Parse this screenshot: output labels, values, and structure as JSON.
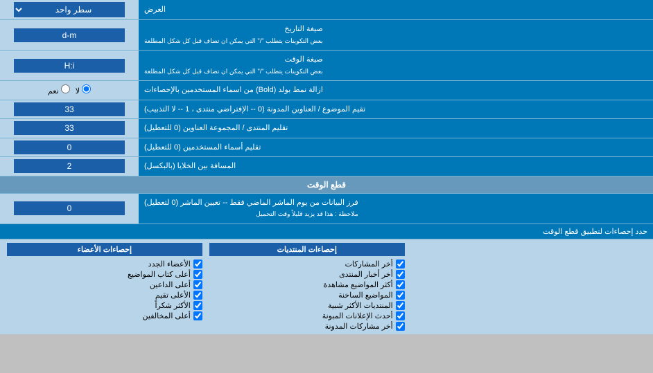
{
  "header": {
    "label": "العرض",
    "dropdown_label": "سطر واحد"
  },
  "rows": [
    {
      "id": "date_format",
      "label": "صيغة التاريخ\nبعض التكوينات يتطلب \"/\" التي يمكن ان تضاف قبل كل شكل المطلعة",
      "input_value": "d-m",
      "type": "input"
    },
    {
      "id": "time_format",
      "label": "صيغة الوقت\nبعض التكوينات يتطلب \"/\" التي يمكن ان تضاف قبل كل شكل المطلعة",
      "input_value": "H:i",
      "type": "input"
    },
    {
      "id": "bold_remove",
      "label": "ازالة نمط بولد (Bold) من اسماء المستخدمين بالإحصاءات",
      "radio_yes": "نعم",
      "radio_no": "لا",
      "selected": "no",
      "type": "radio"
    },
    {
      "id": "topic_order",
      "label": "تقيم الموضوع / العناوين المدونة (0 -- الإفتراضي منتدى ، 1 -- لا التذبيب)",
      "input_value": "33",
      "type": "input"
    },
    {
      "id": "forum_order",
      "label": "تقليم المنتدى / المجموعة العناوين (0 للتعطيل)",
      "input_value": "33",
      "type": "input"
    },
    {
      "id": "user_names",
      "label": "تقليم أسماء المستخدمين (0 للتعطيل)",
      "input_value": "0",
      "type": "input"
    },
    {
      "id": "cell_spacing",
      "label": "المسافة بين الخلايا (بالبكسل)",
      "input_value": "2",
      "type": "input"
    }
  ],
  "section_time": {
    "label": "قطع الوقت"
  },
  "time_row": {
    "label": "فرز البيانات من يوم الماشر الماضي فقط -- تعيين الماشر (0 لتعطيل)\nملاحظة : هذا قد يزيد قليلاً وقت التحميل",
    "input_value": "0"
  },
  "limit_row": {
    "label": "حدد إحصاءات لتطبيق قطع الوقت"
  },
  "checkbox_sections": {
    "col1": {
      "header": "إحصاءات الأعضاء",
      "items": [
        "الأعضاء الجدد",
        "أعلى كتاب المواضيع",
        "أعلى الداعين",
        "الأعلى تقيم",
        "الأكثر شكراً",
        "أعلى المخالفين"
      ]
    },
    "col2": {
      "header": "إحصاءات المنتديات",
      "items": [
        "أخر المشاركات",
        "أخر أخبار المنتدى",
        "أكثر المواضيع مشاهدة",
        "المواضيع الساخنة",
        "المنتديات الأكثر شبية",
        "أحدث الإعلانات المبونة",
        "أخر مشاركات المدونة"
      ]
    },
    "col3": {
      "header": "",
      "items": []
    }
  }
}
